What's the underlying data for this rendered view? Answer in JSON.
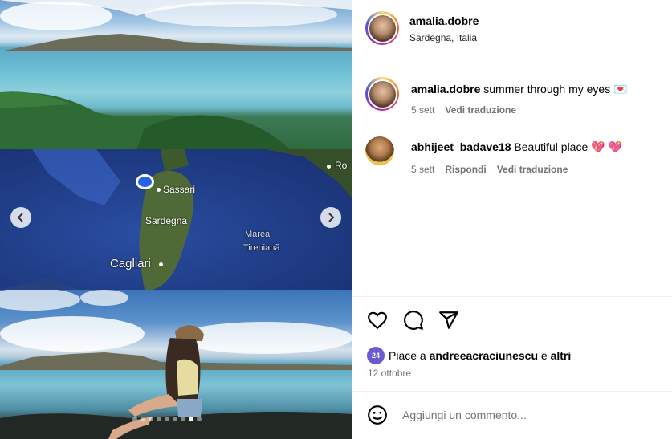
{
  "post": {
    "username": "amalia.dobre",
    "location": "Sardegna, Italia"
  },
  "media": {
    "map_labels": {
      "sassari": "Sassari",
      "sardegna": "Sardegna",
      "cagliari": "Cagliari",
      "marea": "Marea",
      "tireniana": "Tireniană",
      "ro": "Ro"
    },
    "slide_count": 9,
    "active_slide": 8
  },
  "comments": [
    {
      "username": "amalia.dobre",
      "text": "summer through my eyes",
      "emoji": "💌",
      "time": "5 sett",
      "translate": "Vedi traduzione"
    },
    {
      "username": "abhijeet_badave18",
      "text": "Beautiful place",
      "emoji": "💖 💖",
      "time": "5 sett",
      "reply": "Rispondi",
      "translate": "Vedi traduzione"
    }
  ],
  "likes": {
    "prefix": "Piace a",
    "user": "andreeacraciunescu",
    "connector": "e",
    "others": "altri",
    "avatar_badge": "24"
  },
  "date": "12 ottobre",
  "composer": {
    "placeholder": "Aggiungi un commento..."
  },
  "icons": {
    "prev": "chevron-left-icon",
    "next": "chevron-right-icon",
    "like": "heart-icon",
    "comment": "comment-bubble-icon",
    "share": "paper-plane-icon",
    "emoji": "smiley-icon"
  }
}
